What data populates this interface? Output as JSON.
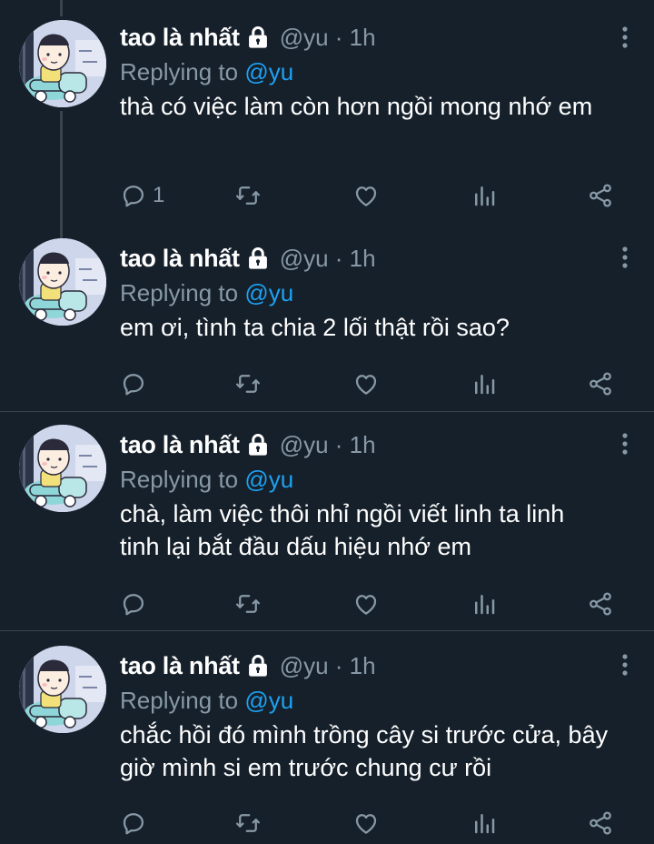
{
  "tweets": [
    {
      "name": "tao là nhất",
      "handle": "@yu · 1h",
      "replying_label": "Replying to ",
      "replying_to": "@yu",
      "text": "thà có việc làm còn hơn ngồi mong nhớ em",
      "reply_count": "1"
    },
    {
      "name": "tao là nhất",
      "handle": "@yu · 1h",
      "replying_label": "Replying to ",
      "replying_to": "@yu",
      "text": "em ơi, tình ta chia 2 lối thật rồi sao?",
      "reply_count": ""
    },
    {
      "name": "tao là nhất",
      "handle": "@yu · 1h",
      "replying_label": "Replying to ",
      "replying_to": "@yu",
      "text": "chà, làm việc thôi nhỉ ngồi viết linh ta linh tinh lại bắt đầu dấu hiệu nhớ em",
      "reply_count": ""
    },
    {
      "name": "tao là nhất",
      "handle": "@yu · 1h",
      "replying_label": "Replying to ",
      "replying_to": "@yu",
      "text": "chắc hồi đó mình trồng cây si trước cửa, bây giờ mình si em trước chung cư rồi",
      "reply_count": ""
    }
  ],
  "icons": {
    "reply": "reply-icon",
    "retweet": "retweet-icon",
    "like": "heart-icon",
    "analytics": "analytics-icon",
    "share": "share-icon",
    "more": "more-vertical-icon",
    "lock": "lock-icon"
  },
  "colors": {
    "background": "#15202b",
    "secondary_text": "#8899a6",
    "link": "#1da1f2",
    "divider": "#38444d"
  }
}
